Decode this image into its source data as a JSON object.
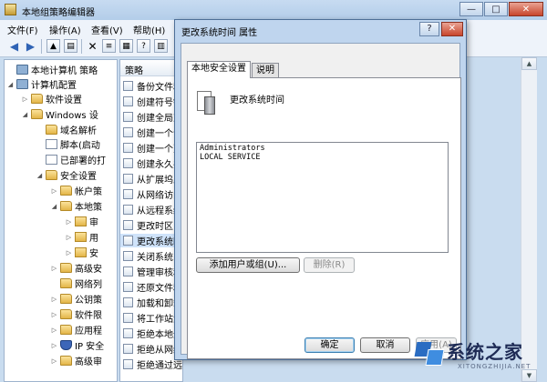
{
  "main_window": {
    "title": "本地组策略编辑器",
    "caption_buttons": {
      "minimize": "—",
      "maximize": "□",
      "close": "✕"
    }
  },
  "menubar": [
    "文件(F)",
    "操作(A)",
    "查看(V)",
    "帮助(H)"
  ],
  "toolbar": {
    "back_icon": "arrow-left-icon",
    "forward_icon": "arrow-right-icon",
    "delete_glyph": "✕"
  },
  "tree": [
    {
      "label": "本地计算机 策略",
      "icon": "computer-icon",
      "toggle": ""
    },
    {
      "label": "计算机配置",
      "icon": "computer-icon",
      "toggle": "◢"
    },
    {
      "label": "软件设置",
      "icon": "folder-icon",
      "toggle": "▷"
    },
    {
      "label": "Windows 设",
      "icon": "folder-icon",
      "toggle": "◢"
    },
    {
      "label": "域名解析",
      "icon": "folder-icon",
      "toggle": ""
    },
    {
      "label": "脚本(启动",
      "icon": "script-icon",
      "toggle": ""
    },
    {
      "label": "已部署的打",
      "icon": "printer-icon",
      "toggle": ""
    },
    {
      "label": "安全设置",
      "icon": "security-icon",
      "toggle": "◢"
    },
    {
      "label": "帐户策",
      "icon": "folder-icon",
      "toggle": "▷"
    },
    {
      "label": "本地策",
      "icon": "folder-icon",
      "toggle": "◢"
    },
    {
      "label": "审",
      "icon": "folder-lock-icon",
      "toggle": "▷"
    },
    {
      "label": "用",
      "icon": "folder-lock-icon",
      "toggle": "▷"
    },
    {
      "label": "安",
      "icon": "folder-lock-icon",
      "toggle": "▷"
    },
    {
      "label": "高级安",
      "icon": "folder-icon",
      "toggle": "▷"
    },
    {
      "label": "网络列",
      "icon": "folder-icon",
      "toggle": ""
    },
    {
      "label": "公钥策",
      "icon": "folder-icon",
      "toggle": "▷"
    },
    {
      "label": "软件限",
      "icon": "folder-icon",
      "toggle": "▷"
    },
    {
      "label": "应用程",
      "icon": "folder-icon",
      "toggle": "▷"
    },
    {
      "label": "IP 安全",
      "icon": "shield-icon",
      "toggle": "▷"
    },
    {
      "label": "高级审",
      "icon": "folder-icon",
      "toggle": "▷"
    }
  ],
  "list": {
    "header": "策略",
    "items": [
      "备份文件和",
      "创建符号链",
      "创建全局对",
      "创建一个令",
      "创建一个页",
      "创建永久共",
      "从扩展坞上",
      "从网络访问",
      "从远程系统",
      "更改时区",
      "更改系统时",
      "关闭系统",
      "管理审核和",
      "还原文件和",
      "加载和卸载",
      "将工作站添",
      "拒绝本地登",
      "拒绝从网络",
      "拒绝通过远"
    ],
    "selected_index": 10
  },
  "dialog": {
    "title": "更改系统时间 属性",
    "help_glyph": "?",
    "close_glyph": "✕",
    "tabs": [
      "本地安全设置",
      "说明"
    ],
    "active_tab": 0,
    "policy_name": "更改系统时间",
    "users": [
      "Administrators",
      "LOCAL SERVICE"
    ],
    "add_button": "添加用户或组(U)...",
    "remove_button": "删除(R)",
    "ok_button": "确定",
    "cancel_button": "取消",
    "apply_button": "应用(A)"
  },
  "watermark": {
    "brand": "系统之家",
    "url": "XITONGZHIJIA.NET"
  },
  "colors": {
    "window_frame": "#c9dcef",
    "selection": "#cfe3fa",
    "close_button": "#c8452c"
  }
}
